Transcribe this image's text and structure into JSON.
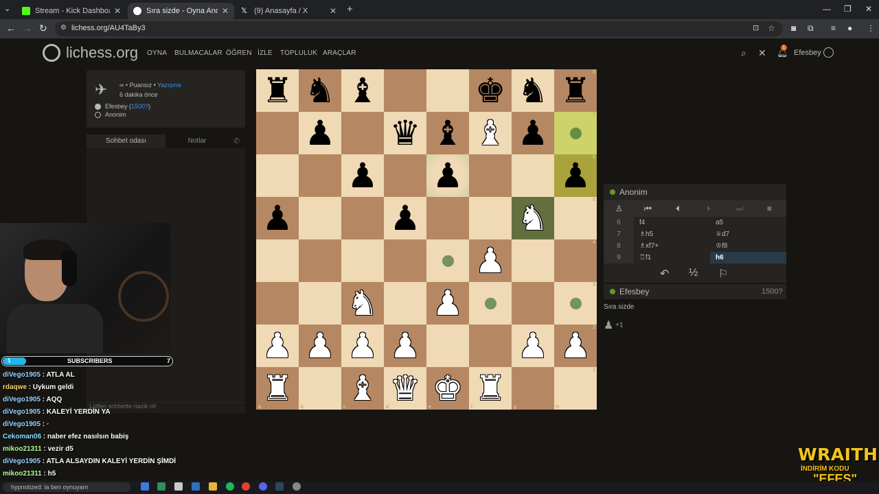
{
  "browser": {
    "tabs": [
      {
        "title": "Stream - Kick Dashboard",
        "color": "#53fc18"
      },
      {
        "title": "Sıra sizde - Oyna Anon. • liches",
        "color": "#ffffff"
      },
      {
        "title": "(9) Anasayfa / X",
        "color": "#ffffff"
      }
    ],
    "url": "lichess.org/AU4TaBy3"
  },
  "site": {
    "logo": "lichess.org",
    "nav": [
      "OYNA",
      "BULMACALAR",
      "ÖĞREN",
      "İZLE",
      "TOPLULUK",
      "ARAÇLAR"
    ],
    "user": "Efesbey",
    "notif_count": "1"
  },
  "game_info": {
    "speed_prefix": "∞ • Puansız •",
    "speed_link": "Yazışma",
    "ago": "6 dakika önce",
    "white": "Efesbey (",
    "white_rating": "1500?",
    "white_close": ")",
    "black": "Anonim"
  },
  "chat": {
    "tab_room": "Sohbet odası",
    "tab_notes": "Notlar",
    "placeholder": "Lütfen sohbette nazik ol!"
  },
  "stream": {
    "subs_count": "1",
    "subs_label": "SUBSCRIBERS",
    "subs_goal": "7",
    "subs_progress": 0.14,
    "messages": [
      {
        "user": "diVego1905",
        "text": "ATLA AL",
        "cls": ""
      },
      {
        "user": "rdaqwe",
        "text": "Uykum geldi",
        "cls": "alt"
      },
      {
        "user": "diVego1905",
        "text": "AQQ",
        "cls": ""
      },
      {
        "user": "diVego1905",
        "text": "KALEYİ YERDİN YA",
        "cls": ""
      },
      {
        "user": "diVego1905",
        "text": "",
        "cls": ""
      },
      {
        "user": "Cekoman06",
        "text": "naber efez nasılsın babiş",
        "cls": "cyan"
      },
      {
        "user": "mikoo21311",
        "text": "vezir d5",
        "cls": "green"
      },
      {
        "user": "diVego1905",
        "text": "ATLA ALSAYDIN KALEYİ YERDİN ŞİMDİ",
        "cls": ""
      },
      {
        "user": "mikoo21311",
        "text": "h5",
        "cls": "green"
      }
    ],
    "promo": [
      "WRAITH",
      "İNDİRİM KODU",
      "\"EFES\""
    ]
  },
  "board": {
    "ranks": [
      [
        "r",
        "n",
        "b",
        "",
        "",
        "k",
        "n",
        "r"
      ],
      [
        "",
        "p",
        "",
        "q",
        "b",
        "B",
        "p",
        ""
      ],
      [
        "",
        "",
        "p",
        "",
        "p",
        "",
        "",
        "p"
      ],
      [
        "p",
        "",
        "",
        "p",
        "",
        "",
        "N",
        ""
      ],
      [
        "",
        "",
        "",
        "",
        "",
        "P",
        "",
        ""
      ],
      [
        "",
        "",
        "N",
        "",
        "P",
        "",
        "",
        ""
      ],
      [
        "P",
        "P",
        "P",
        "P",
        "",
        "",
        "P",
        "P"
      ],
      [
        "R",
        "",
        "B",
        "Q",
        "K",
        "R",
        "",
        ""
      ]
    ],
    "lastmove": [
      "h7",
      "h6"
    ],
    "selected": "g5",
    "check_fade": "e6",
    "dests": [
      "h7",
      "e4",
      "f3",
      "h3"
    ],
    "files": [
      "a",
      "b",
      "c",
      "d",
      "e",
      "f",
      "g",
      "h"
    ]
  },
  "panel": {
    "opponent": "Anonim",
    "moves": [
      {
        "n": "6",
        "w": "f4",
        "b": "a5"
      },
      {
        "n": "7",
        "w": "♗h5",
        "b": "♕d7"
      },
      {
        "n": "8",
        "w": "♗xf7+",
        "b": "♔f8"
      },
      {
        "n": "9",
        "w": "♖f1",
        "b": "h6"
      }
    ],
    "player": "Efesbey",
    "player_rating": "1500?",
    "turn": "Sıra sizde",
    "material": "+1"
  },
  "taskbar": {
    "search": "hypnotized: la ben oynuyam"
  }
}
